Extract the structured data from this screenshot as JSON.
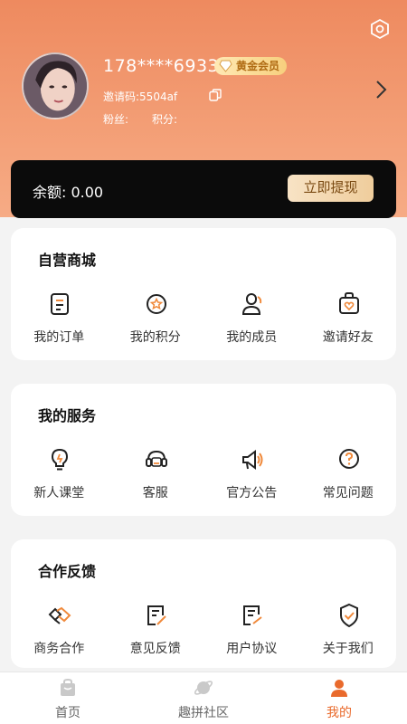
{
  "profile": {
    "phone": "178****6933",
    "vip_badge": "黄金会员",
    "invite_code": "邀请码:5504af",
    "fans_label": "粉丝:",
    "points_label": "积分:"
  },
  "balance": {
    "text": "余额: 0.00",
    "withdraw_label": "立即提现"
  },
  "sections": [
    {
      "title": "自营商城",
      "items": [
        {
          "label": "我的订单",
          "icon": "order-icon"
        },
        {
          "label": "我的积分",
          "icon": "points-icon"
        },
        {
          "label": "我的成员",
          "icon": "members-icon"
        },
        {
          "label": "邀请好友",
          "icon": "invite-friends-icon"
        }
      ]
    },
    {
      "title": "我的服务",
      "items": [
        {
          "label": "新人课堂",
          "icon": "lightbulb-icon"
        },
        {
          "label": "客服",
          "icon": "customer-service-icon"
        },
        {
          "label": "官方公告",
          "icon": "megaphone-icon"
        },
        {
          "label": "常见问题",
          "icon": "question-icon"
        }
      ]
    },
    {
      "title": "合作反馈",
      "items": [
        {
          "label": "商务合作",
          "icon": "handshake-icon"
        },
        {
          "label": "意见反馈",
          "icon": "feedback-icon"
        },
        {
          "label": "用户协议",
          "icon": "agreement-icon"
        },
        {
          "label": "关于我们",
          "icon": "shield-check-icon"
        }
      ]
    }
  ],
  "tabbar": {
    "items": [
      {
        "label": "首页",
        "icon": "home-bag-icon"
      },
      {
        "label": "趣拼社区",
        "icon": "planet-icon"
      },
      {
        "label": "我的",
        "icon": "person-icon"
      }
    ],
    "active_index": 2
  },
  "colors": {
    "header_gradient_top": "#ee8a5f",
    "accent": "#e96a2c",
    "icon_accent": "#f08a3c",
    "gold": "#efcd9c"
  }
}
